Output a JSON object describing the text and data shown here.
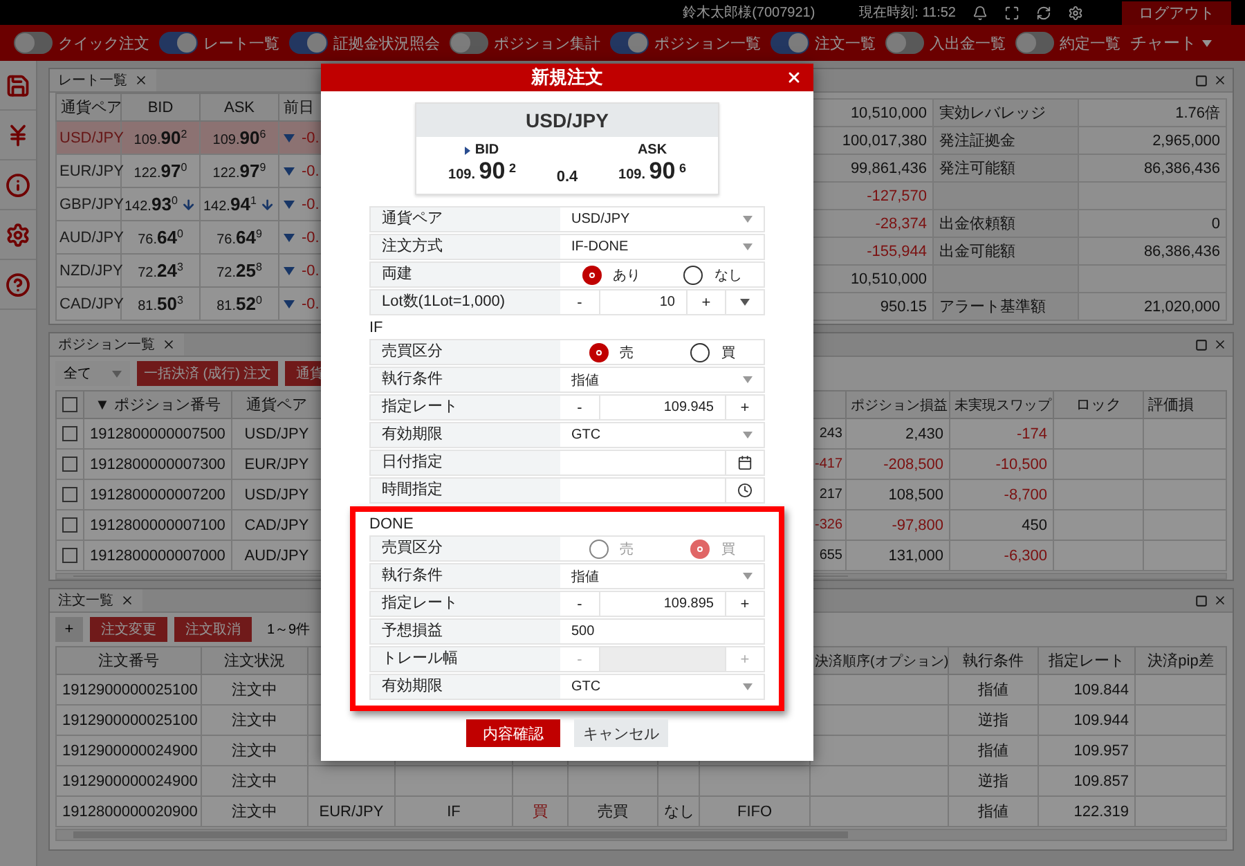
{
  "top_bar": {
    "user": "鈴木太郎様(7007921)",
    "clock": "現在時刻: 11:52",
    "logout": "ログアウト"
  },
  "toolbar": {
    "toggles": [
      {
        "label": "クイック注文",
        "on": false
      },
      {
        "label": "レート一覧",
        "on": true
      },
      {
        "label": "証拠金状況照会",
        "on": true
      },
      {
        "label": "ポジション集計",
        "on": false
      },
      {
        "label": "ポジション一覧",
        "on": true
      },
      {
        "label": "注文一覧",
        "on": true
      },
      {
        "label": "入出金一覧",
        "on": false
      },
      {
        "label": "約定一覧",
        "on": false
      }
    ],
    "chart_menu": "チャート"
  },
  "rate_panel": {
    "tab": "レート一覧",
    "columns": [
      "通貨ペア",
      "BID",
      "ASK",
      "前日"
    ],
    "rows": [
      {
        "pair": "USD/JPY",
        "selected": true,
        "bid": "109.**90**$^{2}$",
        "bid_down": false,
        "ask": "109.**90**$^{6}$",
        "ask_down": false,
        "change": "-0."
      },
      {
        "pair": "EUR/JPY",
        "selected": false,
        "bid": "122.**97**$^{0}$",
        "bid_down": false,
        "ask": "122.**97**$^{9}$",
        "ask_down": false,
        "change": "-0."
      },
      {
        "pair": "GBP/JPY",
        "selected": false,
        "bid": "142.**93**$^{0}$",
        "bid_down": true,
        "ask": "142.**94**$^{1}$",
        "ask_down": true,
        "change": "-0."
      },
      {
        "pair": "AUD/JPY",
        "selected": false,
        "bid": "76.**64**$^{0}$",
        "bid_down": false,
        "ask": "76.**64**$^{9}$",
        "ask_down": false,
        "change": "-0."
      },
      {
        "pair": "NZD/JPY",
        "selected": false,
        "bid": "72.**24**$^{3}$",
        "bid_down": false,
        "ask": "72.**25**$^{8}$",
        "ask_down": false,
        "change": "-0."
      },
      {
        "pair": "CAD/JPY",
        "selected": false,
        "bid": "81.**50**$^{3}$",
        "bid_down": false,
        "ask": "81.**52**$^{0}$",
        "ask_down": false,
        "change": "-0."
      }
    ]
  },
  "account": {
    "rows": [
      {
        "amount": "10,510,000",
        "negative": false,
        "label": "実効レバレッジ",
        "value": "1.76倍"
      },
      {
        "amount": "100,017,380",
        "negative": false,
        "label": "発注証拠金",
        "value": "2,965,000"
      },
      {
        "amount": "99,861,436",
        "negative": false,
        "label": "発注可能額",
        "value": "86,386,436"
      },
      {
        "amount": "-127,570",
        "negative": true
      },
      {
        "amount": "-28,374",
        "negative": true,
        "label": "出金依頼額",
        "value": "0"
      },
      {
        "amount": "-155,944",
        "negative": true,
        "label": "出金可能額",
        "value": "86,386,436"
      },
      {
        "amount": "10,510,000",
        "negative": false
      },
      {
        "amount": "950.15",
        "negative": false,
        "label": "アラート基準額",
        "value": "21,020,000"
      }
    ]
  },
  "positions": {
    "tab": "ポジション一覧",
    "filter": "全て",
    "close_all": "一括決済 (成行) 注文",
    "pair_button": "通貨",
    "header_checked": false,
    "columns": [
      "▼ ポジション番号",
      "通貨ペア",
      "ポジション損益",
      "未実現スワップ",
      "ロック",
      "評価損"
    ],
    "rows": [
      {
        "checked": false,
        "id": "1912800000007500",
        "pair": "USD/JPY",
        "pips": "243",
        "pips_negative": false,
        "pl": "2,430",
        "pl_negative": false,
        "swap": "-174",
        "swap_negative": true
      },
      {
        "checked": false,
        "id": "1912800000007300",
        "pair": "EUR/JPY",
        "pips": "-417",
        "pips_negative": true,
        "pl": "-208,500",
        "pl_negative": true,
        "swap": "-10,500",
        "swap_negative": true
      },
      {
        "checked": false,
        "id": "1912800000007200",
        "pair": "USD/JPY",
        "pips": "217",
        "pips_negative": false,
        "pl": "108,500",
        "pl_negative": false,
        "swap": "-8,700",
        "swap_negative": true
      },
      {
        "checked": false,
        "id": "1912800000007100",
        "pair": "CAD/JPY",
        "pips": "-326",
        "pips_negative": true,
        "pl": "-97,800",
        "pl_negative": true,
        "swap": "450",
        "swap_negative": false
      },
      {
        "checked": false,
        "id": "1912800000007000",
        "pair": "AUD/JPY",
        "pips": "655",
        "pips_negative": false,
        "pl": "131,000",
        "pl_negative": false,
        "swap": "-6,300",
        "swap_negative": true
      }
    ]
  },
  "orders": {
    "tab": "注文一覧",
    "add": "+",
    "change": "注文変更",
    "cancel": "注文取消",
    "count": "1～9件",
    "columns": [
      "注文番号",
      "注文状況",
      "決済順序(オプション)",
      "執行条件",
      "指定レート",
      "決済pip差"
    ],
    "rows": [
      {
        "id": "1912900000025100",
        "status": "注文中",
        "condition": "指値",
        "rate": "109.844"
      },
      {
        "id": "1912900000025100",
        "status": "注文中",
        "condition": "逆指",
        "rate": "109.944"
      },
      {
        "id": "1912900000024900",
        "status": "注文中",
        "condition": "指値",
        "rate": "109.957"
      },
      {
        "id": "1912900000024900",
        "status": "注文中",
        "condition": "逆指",
        "rate": "109.857"
      },
      {
        "id": "1912800000020900",
        "status": "注文中",
        "pair": "EUR/JPY",
        "type": "IF",
        "side": "買",
        "link": "売買",
        "hedge": "なし",
        "order": "FIFO",
        "condition": "指値",
        "rate": "122.319"
      }
    ]
  },
  "order_modal": {
    "title": "新規注文",
    "quote": {
      "pair": "USD/JPY",
      "bid_label": "BID",
      "ask_label": "ASK",
      "bid": "109. **90** $^{2}$",
      "spread": "0.4",
      "ask": "109. **90** $^{6}$"
    },
    "rows": [
      {
        "kind": "select",
        "label": "通貨ペア",
        "value": "USD/JPY",
        "disabled": false
      },
      {
        "kind": "select",
        "label": "注文方式",
        "value": "IF-DONE",
        "disabled": false
      },
      {
        "kind": "radio",
        "label": "両建",
        "disabled": false,
        "options": [
          {
            "label": "あり",
            "selected": true
          },
          {
            "label": "なし",
            "selected": false
          }
        ]
      },
      {
        "kind": "stepper",
        "label": "Lot数(1Lot=1,000)",
        "minus": "-",
        "value": "10",
        "plus": "+",
        "menu": true,
        "disabled": false
      }
    ],
    "sections": [
      {
        "title": "IF",
        "highlighted": false,
        "rows": [
          {
            "kind": "radio",
            "label": "売買区分",
            "disabled": false,
            "options": [
              {
                "label": "売",
                "selected": true
              },
              {
                "label": "買",
                "selected": false
              }
            ]
          },
          {
            "kind": "select",
            "label": "執行条件",
            "value": "指値",
            "disabled": false
          },
          {
            "kind": "stepper",
            "label": "指定レート",
            "minus": "-",
            "value": "109.945",
            "plus": "+",
            "menu": false,
            "disabled": false
          },
          {
            "kind": "select",
            "label": "有効期限",
            "value": "GTC",
            "disabled": false
          },
          {
            "kind": "date",
            "label": "日付指定",
            "disabled": false
          },
          {
            "kind": "time",
            "label": "時間指定",
            "disabled": false
          }
        ]
      },
      {
        "title": "DONE",
        "highlighted": true,
        "rows": [
          {
            "kind": "radio",
            "label": "売買区分",
            "disabled": true,
            "options": [
              {
                "label": "売",
                "selected": false
              },
              {
                "label": "買",
                "selected": true
              }
            ]
          },
          {
            "kind": "select",
            "label": "執行条件",
            "value": "指値",
            "disabled": false
          },
          {
            "kind": "stepper",
            "label": "指定レート",
            "minus": "-",
            "value": "109.895",
            "plus": "+",
            "menu": false,
            "disabled": false
          },
          {
            "kind": "text",
            "label": "予想損益",
            "value": "500",
            "disabled": false
          },
          {
            "kind": "stepper",
            "label": "トレール幅",
            "minus": "-",
            "plus": "+",
            "menu": false,
            "disabled": true
          },
          {
            "kind": "select",
            "label": "有効期限",
            "value": "GTC",
            "disabled": false
          }
        ]
      }
    ],
    "confirm": "内容確認",
    "cancel": "キャンセル"
  }
}
